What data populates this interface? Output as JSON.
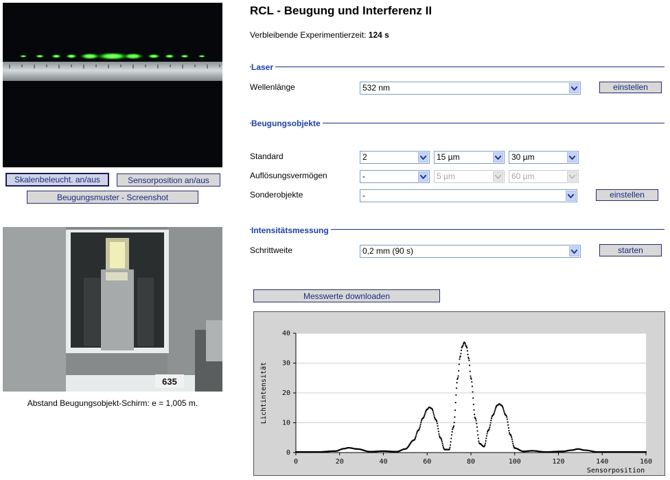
{
  "page_title": "RCL - Beugung und Interferenz II",
  "remaining_time": {
    "label": "Verbleibende Experimentierzeit:",
    "value": "124 s"
  },
  "left": {
    "buttons": {
      "scale_light": "Skalenbeleucht. an/aus",
      "sensor_position": "Sensorposition an/aus",
      "screenshot": "Beugungsmuster - Screenshot"
    },
    "camera2_label": "635",
    "distance_caption": "Abstand Beugungsobjekt-Schirm: e = 1,005 m."
  },
  "laser": {
    "section_title": "Laser",
    "wavelength_label": "Wellenlänge",
    "wavelength_value": "532 nm",
    "set_button": "einstellen"
  },
  "objects": {
    "section_title": "Beugungsobjekte",
    "standard_label": "Standard",
    "standard_values": [
      "2",
      "15 µm",
      "30 µm"
    ],
    "resolution_label": "Auflösungsvermögen",
    "resolution_values": [
      "-",
      "5 µm",
      "60 µm"
    ],
    "special_label": "Sonderobjekte",
    "special_value": "-",
    "set_button": "einstellen"
  },
  "measurement": {
    "section_title": "Intensitätsmessung",
    "step_label": "Schrittweite",
    "step_value": "0,2 mm (90 s)",
    "start_button": "starten",
    "download_button": "Messwerte downloaden"
  },
  "chart_data": {
    "type": "scatter",
    "xlabel": "Sensorposition",
    "ylabel": "Lichtintensität",
    "xlim": [
      0,
      160
    ],
    "ylim": [
      0,
      40
    ],
    "xticks": [
      0,
      20,
      40,
      60,
      80,
      100,
      120,
      140,
      160
    ],
    "yticks": [
      0,
      10,
      20,
      30,
      40
    ],
    "grid": "horizontal",
    "series": [
      {
        "color": "#000000",
        "x": [
          0,
          10,
          18,
          22,
          24,
          28,
          34,
          40,
          46,
          50,
          54,
          56,
          58,
          60,
          61,
          62,
          64,
          66,
          68,
          70,
          72,
          74,
          75,
          76,
          77,
          78,
          79,
          80,
          82,
          84,
          86,
          88,
          90,
          92,
          93,
          94,
          96,
          98,
          100,
          104,
          108,
          114,
          122,
          126,
          129,
          132,
          138,
          150,
          160
        ],
        "y": [
          0.2,
          0.2,
          0.5,
          1.3,
          1.6,
          1.2,
          0.3,
          0.5,
          0.3,
          1.2,
          4.2,
          7.5,
          11.5,
          14.5,
          15.2,
          14.8,
          11.0,
          5.0,
          1.0,
          1.0,
          8.5,
          25.0,
          32.0,
          35.5,
          37.0,
          35.5,
          31.5,
          25.0,
          11.5,
          3.0,
          2.0,
          7.5,
          12.5,
          15.8,
          16.3,
          15.8,
          12.5,
          6.0,
          1.5,
          0.4,
          0.6,
          0.2,
          0.4,
          0.8,
          1.2,
          0.8,
          0.2,
          0.2,
          0.2
        ]
      }
    ]
  },
  "colors": {
    "accent": "#1f3fa8",
    "button_bg": "#d8d8d8",
    "line": "#1a2a80"
  }
}
